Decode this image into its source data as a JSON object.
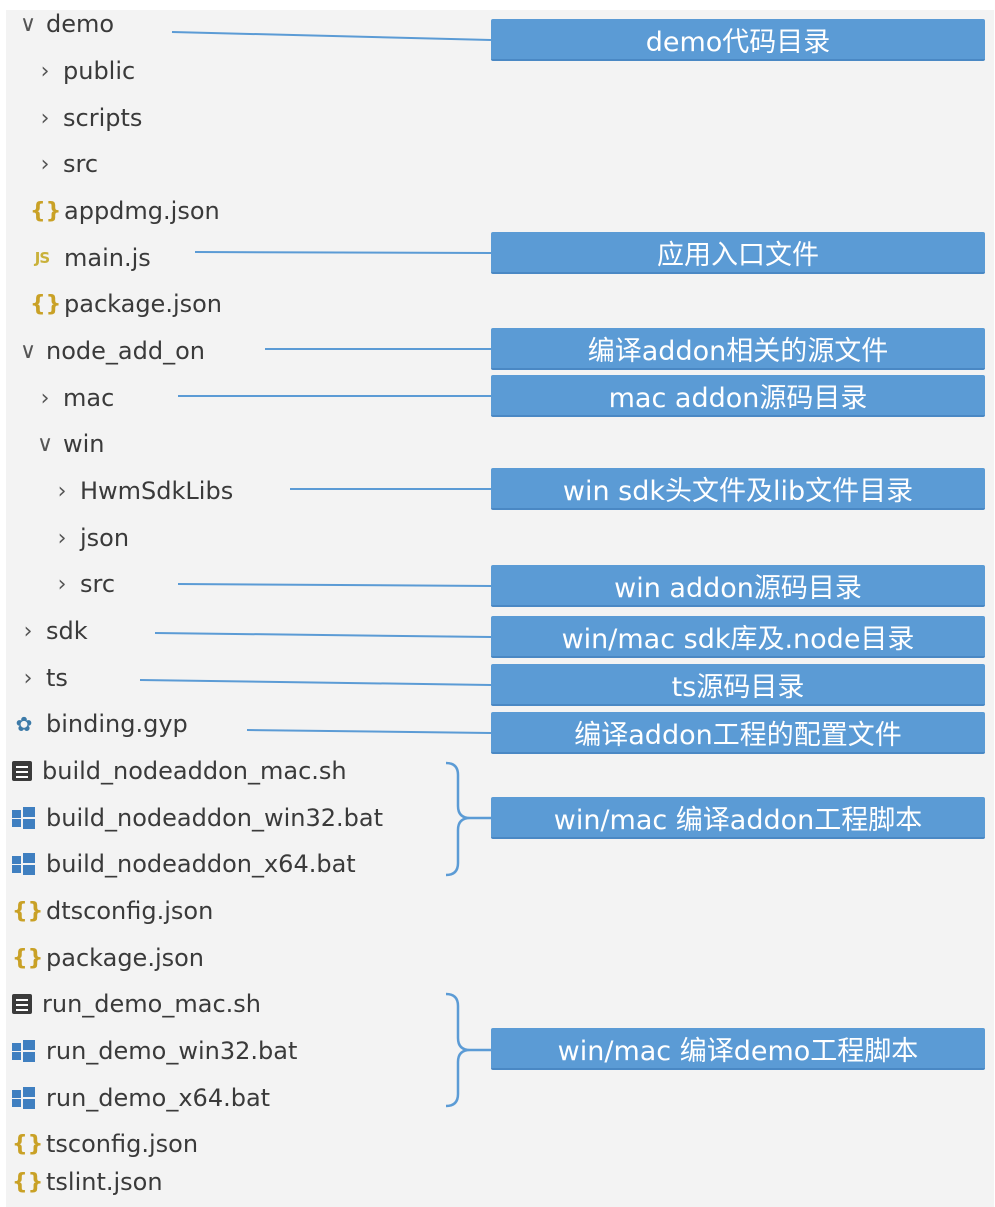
{
  "tree": [
    {
      "label": "demo",
      "expanded": true
    },
    {
      "label": "public",
      "expanded": false
    },
    {
      "label": "scripts",
      "expanded": false
    },
    {
      "label": "src",
      "expanded": false
    },
    {
      "label": "appdmg.json",
      "icon": "json-braces-icon"
    },
    {
      "label": "main.js",
      "icon": "js-file-icon"
    },
    {
      "label": "package.json",
      "icon": "json-braces-icon"
    },
    {
      "label": "node_add_on",
      "expanded": true
    },
    {
      "label": "mac",
      "expanded": false
    },
    {
      "label": "win",
      "expanded": true
    },
    {
      "label": "HwmSdkLibs",
      "expanded": false
    },
    {
      "label": "json",
      "expanded": false
    },
    {
      "label": "src",
      "expanded": false
    },
    {
      "label": "sdk",
      "expanded": false
    },
    {
      "label": "ts",
      "expanded": false
    },
    {
      "label": "binding.gyp",
      "icon": "python-gyp-icon"
    },
    {
      "label": "build_nodeaddon_mac.sh",
      "icon": "shell-script-icon"
    },
    {
      "label": "build_nodeaddon_win32.bat",
      "icon": "windows-bat-icon"
    },
    {
      "label": "build_nodeaddon_x64.bat",
      "icon": "windows-bat-icon"
    },
    {
      "label": "dtsconfig.json",
      "icon": "json-braces-icon"
    },
    {
      "label": "package.json",
      "icon": "json-braces-icon"
    },
    {
      "label": "run_demo_mac.sh",
      "icon": "shell-script-icon"
    },
    {
      "label": "run_demo_win32.bat",
      "icon": "windows-bat-icon"
    },
    {
      "label": "run_demo_x64.bat",
      "icon": "windows-bat-icon"
    },
    {
      "label": "tsconfig.json",
      "icon": "json-braces-icon"
    },
    {
      "label": "tslint.json",
      "icon": "json-braces-icon"
    }
  ],
  "annotations": [
    "demo代码目录",
    "应用入口文件",
    "编译addon相关的源文件",
    "mac addon源码目录",
    "win sdk头文件及lib文件目录",
    "win addon源码目录",
    "win/mac sdk库及.node目录",
    "ts源码目录",
    "编译addon工程的配置文件",
    "win/mac 编译addon工程脚本",
    "win/mac 编译demo工程脚本"
  ],
  "colors": {
    "callout_fill": "#5b9bd5",
    "connector_line": "#5b9bd5",
    "tree_background": "#f3f3f3",
    "json_icon": "#c9a126",
    "windows_icon": "#3f7fc0"
  }
}
